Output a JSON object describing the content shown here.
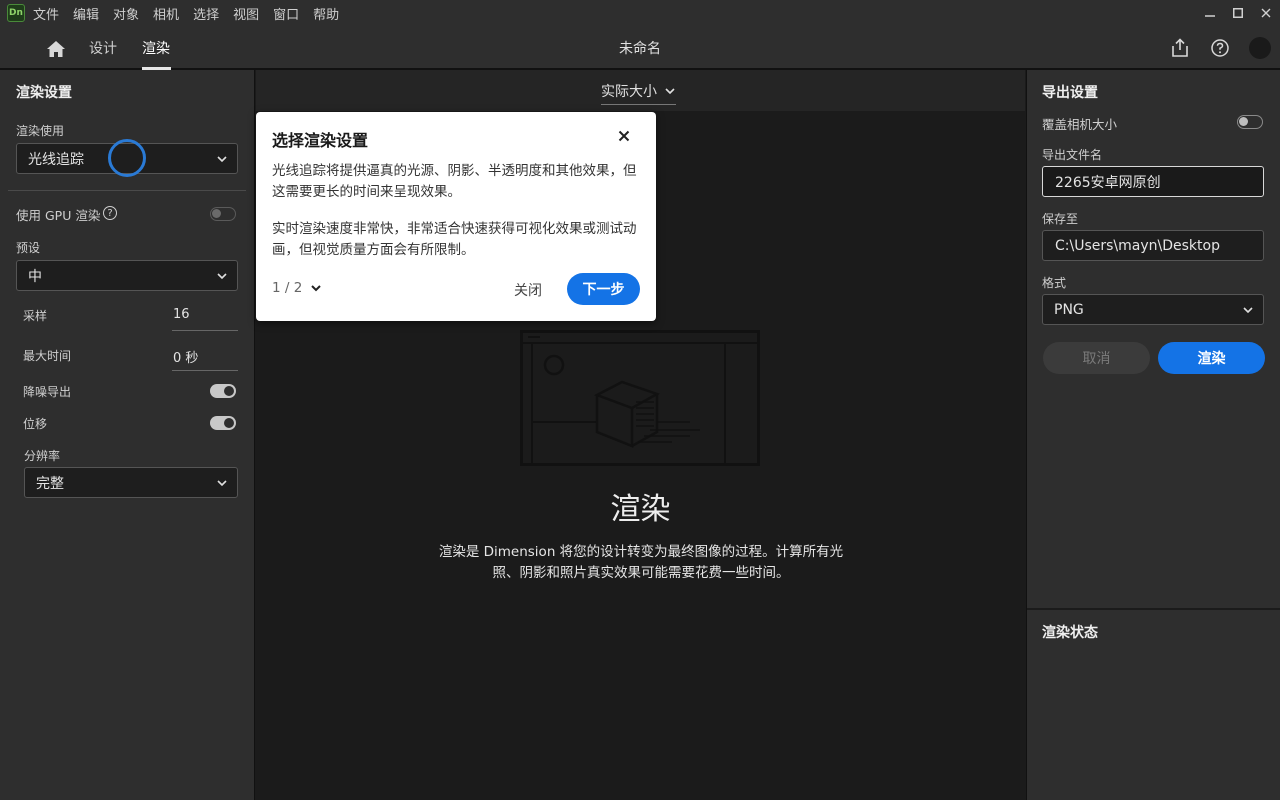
{
  "app": {
    "logo_text": "Dn"
  },
  "menu": [
    "文件",
    "编辑",
    "对象",
    "相机",
    "选择",
    "视图",
    "窗口",
    "帮助"
  ],
  "window_controls": {
    "minimize": "▬",
    "maximize": "▢",
    "close": "✕"
  },
  "header": {
    "tabs": [
      "设计",
      "渲染"
    ],
    "active_tab": "渲染",
    "document_title": "未命名"
  },
  "left_panel": {
    "title": "渲染设置",
    "render_using_label": "渲染使用",
    "render_using_value": "光线追踪",
    "gpu_label": "使用 GPU 渲染",
    "gpu_on": false,
    "preset_label": "预设",
    "preset_value": "中",
    "samples_label": "采样",
    "samples_value": "16",
    "max_time_label": "最大时间",
    "max_time_value": "0 秒",
    "denoise_label": "降噪导出",
    "denoise_on": true,
    "offset_label": "位移",
    "offset_on": true,
    "resolution_label": "分辨率",
    "resolution_value": "完整"
  },
  "center": {
    "zoom_label": "实际大小",
    "empty_title": "渲染",
    "empty_description": "渲染是 Dimension 将您的设计转变为最终图像的过程。计算所有光照、阴影和照片真实效果可能需要花费一些时间。"
  },
  "popover": {
    "title": "选择渲染设置",
    "para1": "光线追踪将提供逼真的光源、阴影、半透明度和其他效果，但这需要更长的时间来呈现效果。",
    "para2": "实时渲染速度非常快，非常适合快速获得可视化效果或测试动画，但视觉质量方面会有所限制。",
    "step": "1 / 2",
    "close_label": "关闭",
    "next_label": "下一步"
  },
  "right_panel": {
    "title": "导出设置",
    "override_camera_label": "覆盖相机大小",
    "override_camera_on": false,
    "filename_label": "导出文件名",
    "filename_value": "2265安卓网原创",
    "save_to_label": "保存至",
    "save_to_value": "C:\\Users\\mayn\\Desktop",
    "format_label": "格式",
    "format_value": "PNG",
    "cancel_label": "取消",
    "render_label": "渲染",
    "status_title": "渲染状态"
  },
  "colors": {
    "accent": "#1473e6",
    "panel": "#2e2e2e",
    "canvas": "#1b1b1b",
    "focus": "#2a7ad5"
  }
}
